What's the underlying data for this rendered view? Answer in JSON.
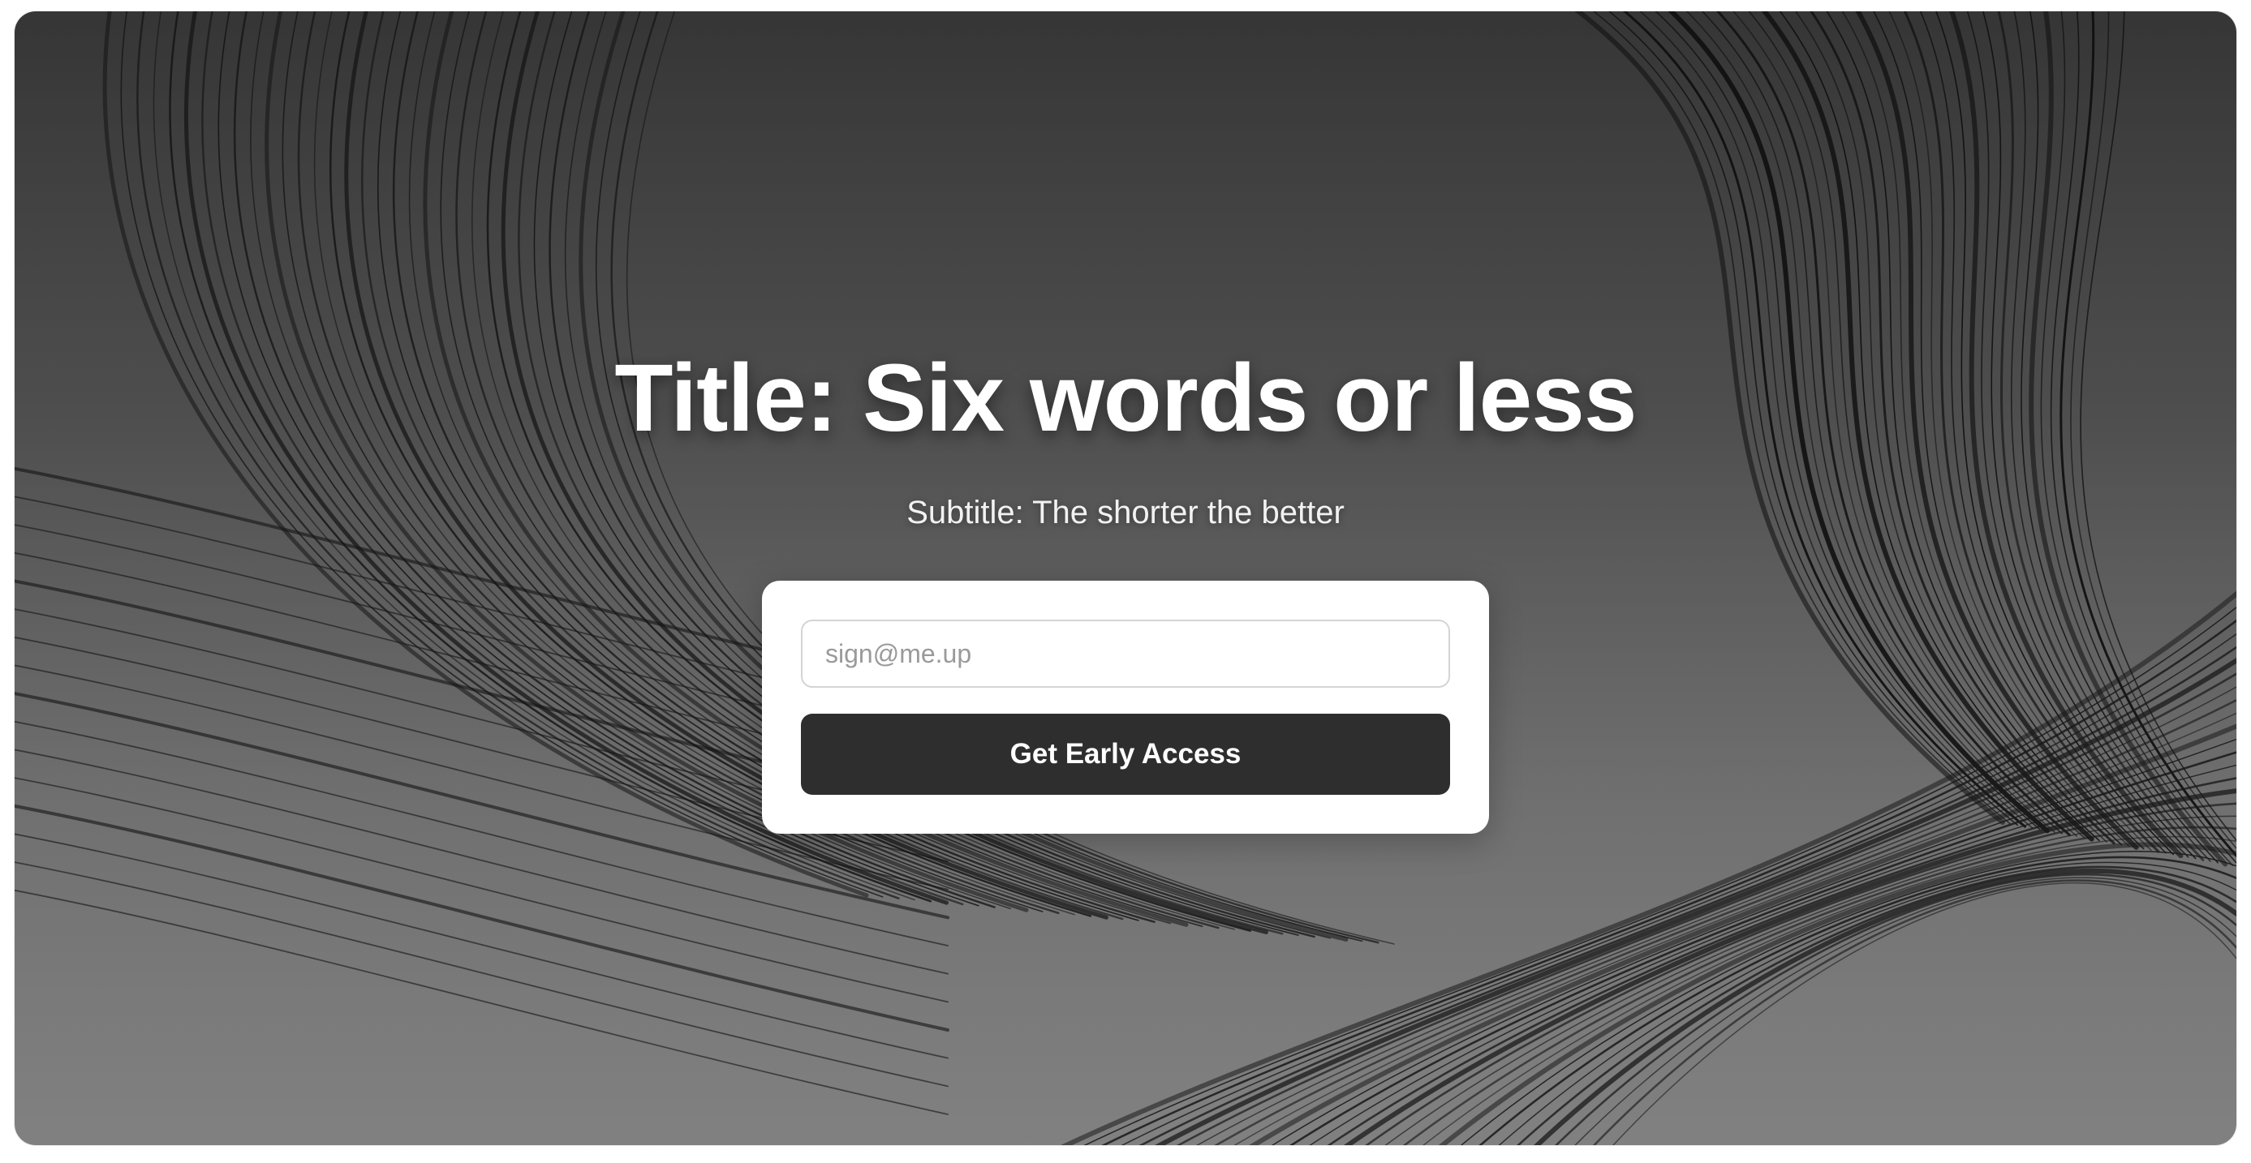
{
  "hero": {
    "title": "Title: Six words or less",
    "subtitle": "Subtitle: The shorter the better"
  },
  "signup": {
    "email_placeholder": "sign@me.up",
    "email_value": "",
    "button_label": "Get Early Access"
  },
  "colors": {
    "button_background": "#2e2e2e",
    "card_background": "#ffffff",
    "title_text": "#ffffff"
  }
}
